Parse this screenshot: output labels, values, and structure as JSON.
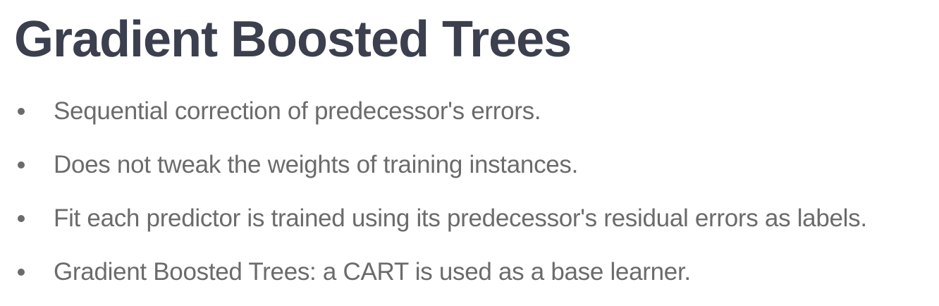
{
  "slide": {
    "title": "Gradient Boosted Trees",
    "bullets": [
      "Sequential correction of predecessor's errors.",
      "Does not tweak the weights of training instances.",
      "Fit each predictor is trained using its predecessor's residual errors as labels.",
      "Gradient Boosted Trees: a CART is used as a base learner."
    ]
  },
  "colors": {
    "title": "#3b3f4e",
    "body_text": "#6b6b6b",
    "background": "#ffffff"
  }
}
